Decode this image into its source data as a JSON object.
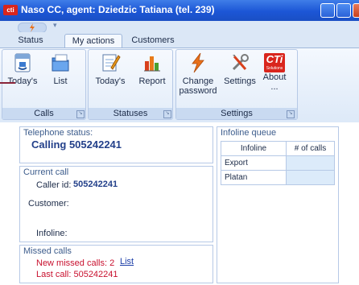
{
  "window": {
    "title": "Naso CC, agent: Dziedzic Tatiana (tel. 239)",
    "logo_text": "cti"
  },
  "tabs": [
    {
      "label": "Status"
    },
    {
      "label": "My actions"
    },
    {
      "label": "Customers"
    }
  ],
  "ribbon": {
    "groups": {
      "calls": {
        "caption": "Calls",
        "buttons": [
          {
            "label": "Today's"
          },
          {
            "label": "List"
          }
        ]
      },
      "statuses": {
        "caption": "Statuses",
        "buttons": [
          {
            "label": "Today's"
          },
          {
            "label": "Report"
          }
        ]
      },
      "settings": {
        "caption": "Settings",
        "buttons": [
          {
            "label": "Change password"
          },
          {
            "label": "Settings"
          },
          {
            "label": "About ..."
          }
        ]
      }
    },
    "about_logo": {
      "big": "CTi",
      "small": "Solutions"
    }
  },
  "telephone_status": {
    "title": "Telephone status:",
    "value": "Calling 505242241"
  },
  "current_call": {
    "title": "Current call",
    "caller_id_label": "Caller id:",
    "caller_id_value": "505242241",
    "customer_label": "Customer:",
    "infoline_label": "Infoline:"
  },
  "missed_calls": {
    "title": "Missed calls",
    "new_missed": "New missed calls: 2",
    "last_call": "Last call: 505242241",
    "list_link": "List"
  },
  "infoline_queue": {
    "title": "Infoline queue",
    "columns": [
      "Infoline",
      "# of calls"
    ],
    "rows": [
      {
        "infoline": "Export",
        "calls": ""
      },
      {
        "infoline": "Platan",
        "calls": ""
      }
    ]
  }
}
